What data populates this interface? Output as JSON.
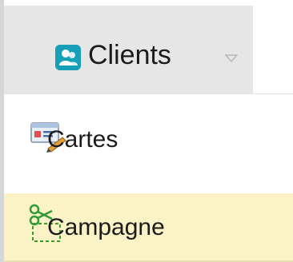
{
  "menu": {
    "header": {
      "label": "Clients",
      "icon": "clients-icon",
      "chevron_icon": "chevron-down-icon",
      "icon_color": "#16a0b8",
      "background": "#e6e6e6"
    },
    "items": [
      {
        "label": "Cartes",
        "icon": "card-icon",
        "selected": false
      },
      {
        "label": "Campagne",
        "icon": "scissors-icon",
        "selected": true,
        "highlight_color": "#fbf3c6"
      }
    ]
  }
}
